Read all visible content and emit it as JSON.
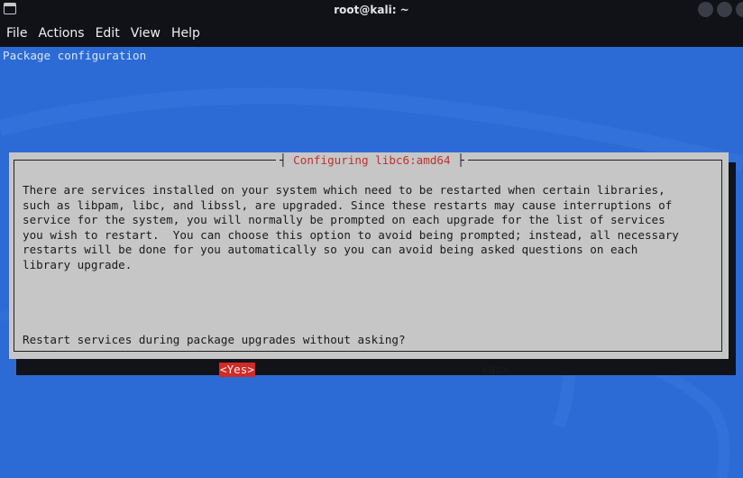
{
  "window": {
    "title": "root@kali: ~"
  },
  "menu": {
    "items": [
      "File",
      "Actions",
      "Edit",
      "View",
      "Help"
    ]
  },
  "terminal": {
    "header": "Package configuration",
    "background_color": "#2c6bd6"
  },
  "dialog": {
    "title": "Configuring libc6:amd64",
    "body_lines": [
      "There are services installed on your system which need to be restarted when certain libraries,",
      "such as libpam, libc, and libssl, are upgraded. Since these restarts may cause interruptions of",
      "service for the system, you will normally be prompted on each upgrade for the list of services",
      "you wish to restart.  You can choose this option to avoid being prompted; instead, all necessary",
      "restarts will be done for you automatically so you can avoid being asked questions on each",
      "library upgrade."
    ],
    "question": "Restart services during package upgrades without asking?",
    "yes_label": "<Yes>",
    "no_label": "<No>",
    "selected": "yes",
    "accent_color": "#d12b25"
  }
}
